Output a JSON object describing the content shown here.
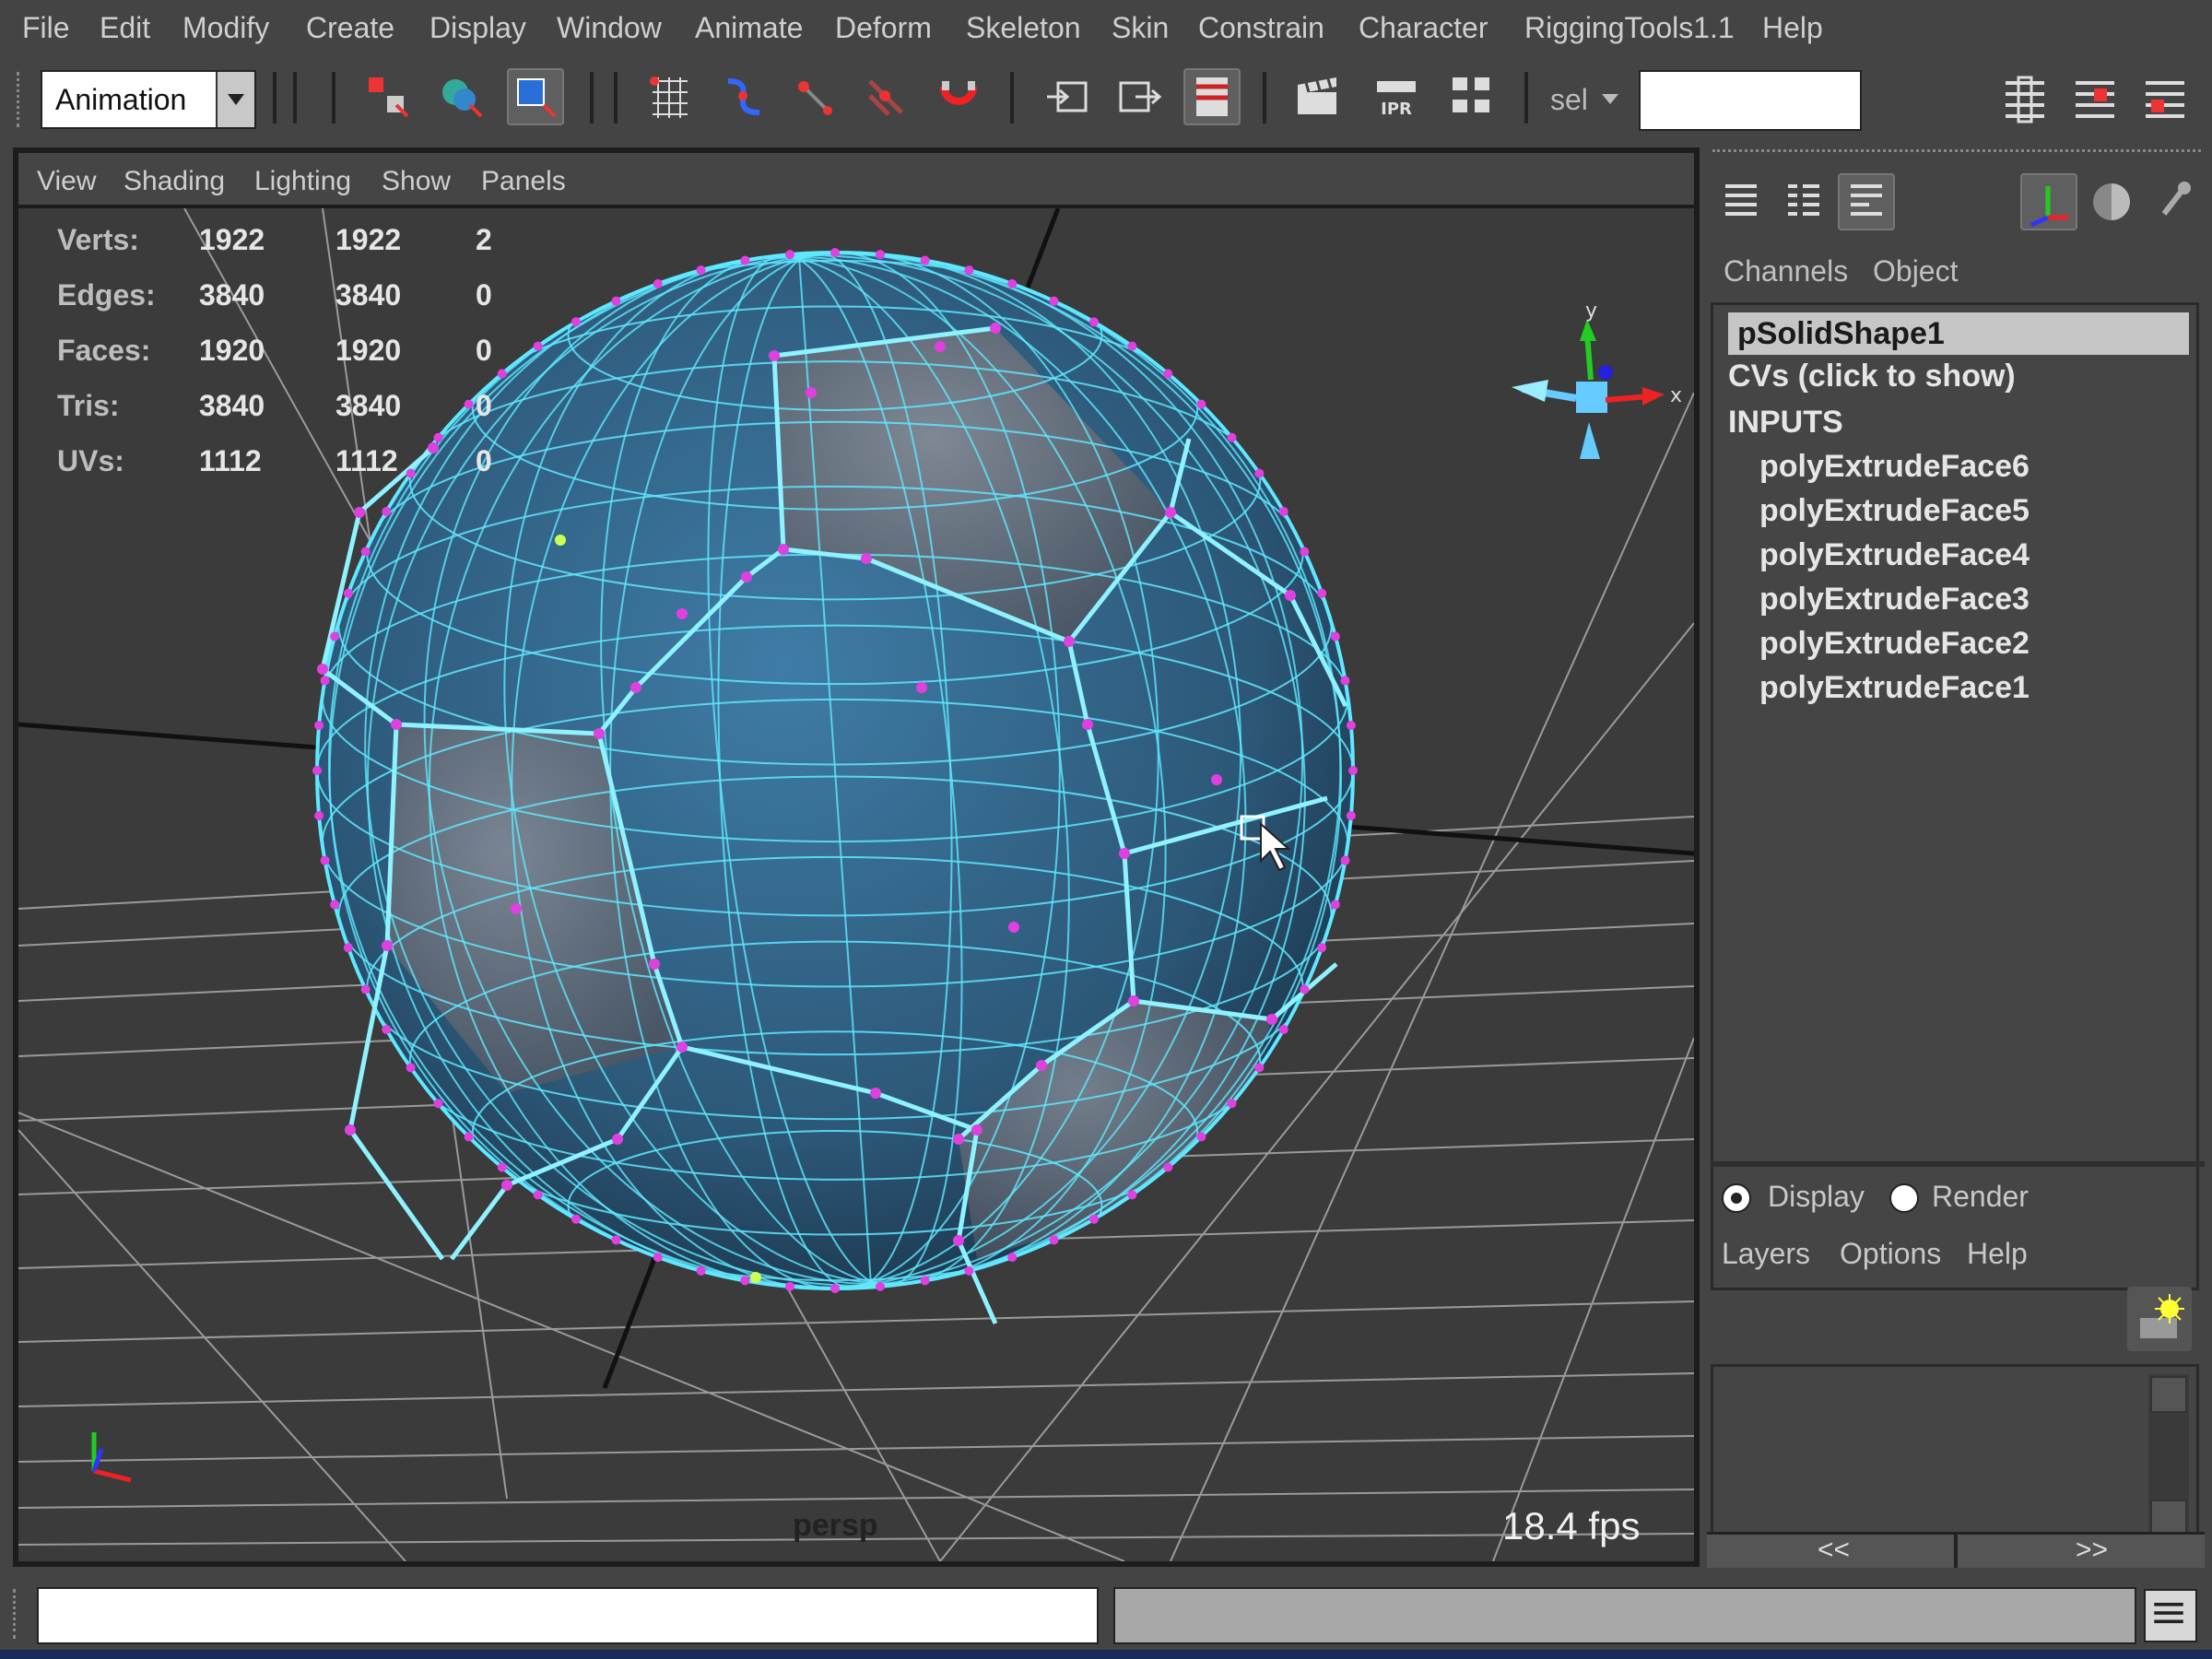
{
  "menubar": {
    "items": [
      "File",
      "Edit",
      "Modify",
      "Create",
      "Display",
      "Window",
      "Animate",
      "Deform",
      "Skeleton",
      "Skin",
      "Constrain",
      "Character",
      "RiggingTools1.1",
      "Help"
    ]
  },
  "toolbar": {
    "mode": "Animation",
    "sel_label": "sel",
    "sel_value": "",
    "ipr_label": "IPR"
  },
  "viewport": {
    "menu": [
      "View",
      "Shading",
      "Lighting",
      "Show",
      "Panels"
    ],
    "hud": {
      "rows": [
        {
          "label": "Verts:",
          "values": [
            "1922",
            "1922",
            "2"
          ]
        },
        {
          "label": "Edges:",
          "values": [
            "3840",
            "3840",
            "0"
          ]
        },
        {
          "label": "Faces:",
          "values": [
            "1920",
            "1920",
            "0"
          ]
        },
        {
          "label": "Tris:",
          "values": [
            "3840",
            "3840",
            "0"
          ]
        },
        {
          "label": "UVs:",
          "values": [
            "1112",
            "1112",
            "0"
          ]
        }
      ]
    },
    "camera": "persp",
    "fps": "18.4 fps",
    "axis_x": "x",
    "axis_y": "y"
  },
  "channel_box": {
    "tabs": [
      "Channels",
      "Object"
    ],
    "node": "pSolidShape1",
    "shape_item": "CVs (click to show)",
    "inputs_header": "INPUTS",
    "inputs": [
      "polyExtrudeFace6",
      "polyExtrudeFace5",
      "polyExtrudeFace4",
      "polyExtrudeFace3",
      "polyExtrudeFace2",
      "polyExtrudeFace1"
    ]
  },
  "layer_editor": {
    "radio_display": "Display",
    "radio_render": "Render",
    "menu": [
      "Layers",
      "Options",
      "Help"
    ],
    "nav_prev": "<<",
    "nav_next": ">>"
  },
  "command_line": {
    "input_value": "",
    "output_value": ""
  },
  "colors": {
    "wire": "#5fe8ff",
    "vertex": "#e040e0",
    "background": "#3b3b3b"
  }
}
